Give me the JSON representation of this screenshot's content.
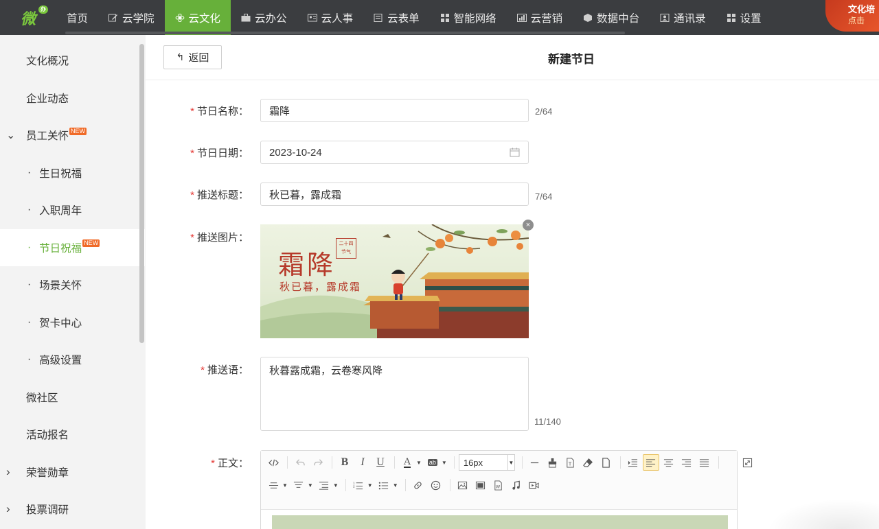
{
  "app": {
    "logo_text": "微",
    "logo_badge": "办"
  },
  "nav": {
    "items": [
      {
        "label": "首页",
        "icon": "none",
        "active": false
      },
      {
        "label": "云学院",
        "icon": "edit-icon",
        "active": false
      },
      {
        "label": "云文化",
        "icon": "flower-icon",
        "active": true
      },
      {
        "label": "云办公",
        "icon": "briefcase-icon",
        "active": false
      },
      {
        "label": "云人事",
        "icon": "id-card-icon",
        "active": false
      },
      {
        "label": "云表单",
        "icon": "form-icon",
        "active": false
      },
      {
        "label": "智能网络",
        "icon": "grid-icon",
        "active": false
      },
      {
        "label": "云营销",
        "icon": "chart-icon",
        "active": false
      },
      {
        "label": "数据中台",
        "icon": "cube-icon",
        "active": false
      },
      {
        "label": "通讯录",
        "icon": "contact-icon",
        "active": false
      },
      {
        "label": "设置",
        "icon": "grid-icon",
        "active": false
      }
    ],
    "promo_title": "文化培",
    "promo_sub": "点击"
  },
  "sidebar": {
    "items": [
      {
        "label": "文化概况"
      },
      {
        "label": "企业动态"
      },
      {
        "label": "员工关怀",
        "badge": "NEW",
        "expanded": true
      },
      {
        "label": "生日祝福"
      },
      {
        "label": "入职周年"
      },
      {
        "label": "节日祝福",
        "badge": "NEW",
        "active": true
      },
      {
        "label": "场景关怀"
      },
      {
        "label": "贺卡中心"
      },
      {
        "label": "高级设置"
      },
      {
        "label": "微社区"
      },
      {
        "label": "活动报名"
      },
      {
        "label": "荣誉勋章",
        "collapsed": true
      },
      {
        "label": "投票调研",
        "collapsed": true
      }
    ]
  },
  "header": {
    "back_label": "返回",
    "title": "新建节日"
  },
  "form": {
    "name": {
      "label": "节日名称：",
      "value": "霜降",
      "counter": "2/64"
    },
    "date": {
      "label": "节日日期：",
      "value": "2023-10-24"
    },
    "push_title": {
      "label": "推送标题：",
      "value": "秋已暮，露成霜",
      "counter": "7/64"
    },
    "push_image": {
      "label": "推送图片：",
      "title": "霜降",
      "subtitle": "秋已暮，露成霜",
      "seal_top": "二十四",
      "seal_bottom": "节气"
    },
    "push_text": {
      "label": "推送语：",
      "value": "秋暮露成霜，云卷寒风降",
      "counter": "11/140"
    },
    "body": {
      "label": "正文：",
      "font_size": "16px"
    }
  },
  "colors": {
    "accent": "#67b03a",
    "topbar": "#3b3d40",
    "required": "#e53935",
    "badge": "#f06a27"
  }
}
